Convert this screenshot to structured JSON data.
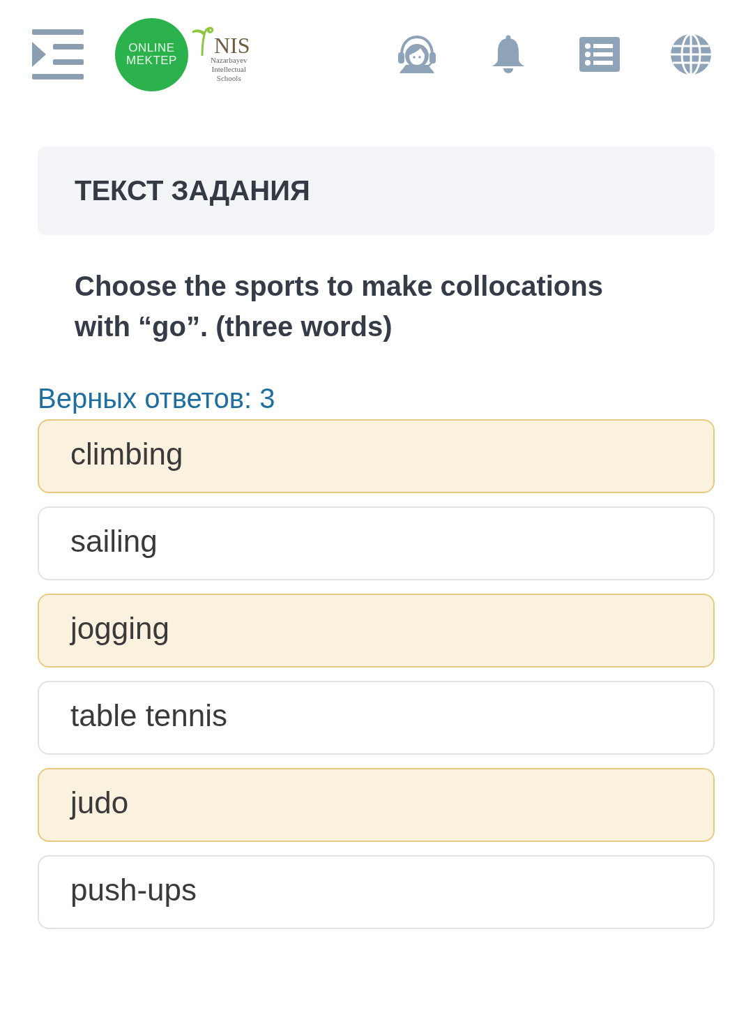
{
  "header": {
    "logo": {
      "circle_lines": [
        "ONLINE",
        "MEKTEP"
      ],
      "brand": "NIS",
      "subtitle_lines": [
        "Nazarbayev",
        "Intellectual",
        "Schools"
      ]
    }
  },
  "task_header": {
    "title": "ТЕКСТ ЗАДАНИЯ"
  },
  "question": "Choose the sports to make collocations with “go”. (three words)",
  "answers_hint": "Верных ответов: 3",
  "options": [
    {
      "label": "climbing",
      "selected": true
    },
    {
      "label": "sailing",
      "selected": false
    },
    {
      "label": "jogging",
      "selected": true
    },
    {
      "label": "table tennis",
      "selected": false
    },
    {
      "label": "judo",
      "selected": true
    },
    {
      "label": "push-ups",
      "selected": false
    }
  ]
}
